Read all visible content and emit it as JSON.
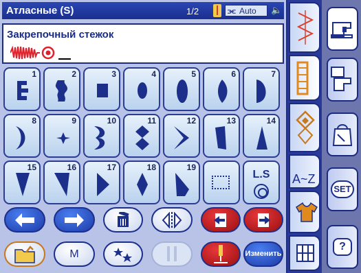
{
  "title_bar": {
    "title": "Атласные (S)",
    "page": "1/2",
    "foot_mode": "Auto"
  },
  "info": {
    "stitch_name": "Закрепочный стежок"
  },
  "stitches": [
    {
      "num": "1",
      "icon": "bartack-zigzag-icon"
    },
    {
      "num": "2",
      "icon": "wave-satin-icon"
    },
    {
      "num": "3",
      "icon": "square-satin-icon"
    },
    {
      "num": "4",
      "icon": "oval-small-icon"
    },
    {
      "num": "5",
      "icon": "oval-long-icon"
    },
    {
      "num": "6",
      "icon": "leaf-satin-icon"
    },
    {
      "num": "7",
      "icon": "half-moon-icon"
    },
    {
      "num": "8",
      "icon": "crescent-icon"
    },
    {
      "num": "9",
      "icon": "star-diamond-icon"
    },
    {
      "num": "10",
      "icon": "double-scallop-icon"
    },
    {
      "num": "11",
      "icon": "double-diamond-icon"
    },
    {
      "num": "12",
      "icon": "chevron-satin-icon"
    },
    {
      "num": "13",
      "icon": "slanted-bar-icon"
    },
    {
      "num": "14",
      "icon": "triangle-up-icon"
    },
    {
      "num": "15",
      "icon": "triangle-down-icon"
    },
    {
      "num": "16",
      "icon": "triangle-slant-icon"
    },
    {
      "num": "17",
      "icon": "arrow-triangle-icon"
    },
    {
      "num": "18",
      "icon": "diamond-tall-icon"
    },
    {
      "num": "19",
      "icon": "slant-right-icon"
    },
    {
      "num": "",
      "icon": "dotted-square-icon"
    },
    {
      "num": "",
      "icon": "ls-icon",
      "label": "L.S"
    }
  ],
  "bottom_buttons": {
    "memory_label": "M",
    "edit_label": "Изменить"
  },
  "colors": {
    "blue_dark": "#1c2f8a",
    "blue_button": "#2a4fc4",
    "red_button": "#c4161c",
    "panel": "#b9c2e7"
  }
}
